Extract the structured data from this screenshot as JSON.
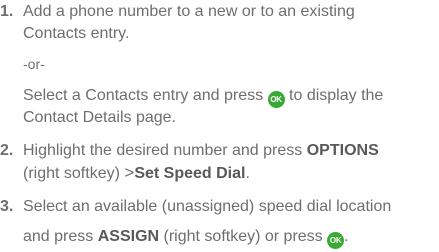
{
  "colors": {
    "text": "#6d6e70",
    "ok_icon": "#3aaa35"
  },
  "steps": [
    {
      "number": "1.",
      "line1": "Add a phone number to a new or to an existing",
      "line2": "Contacts entry.",
      "or": "-or-",
      "alt_line1_pre": "Select a Contacts entry and press",
      "alt_line1_post": "to display the",
      "alt_line2": "Contact Details page."
    },
    {
      "number": "2.",
      "line1_pre": "Highlight the desired number and press",
      "line1_bold": "OPTIONS",
      "line2_pre": "(right softkey)",
      "line2_sep": ">",
      "line2_bold": "Set Speed Dial",
      "line2_post": "."
    },
    {
      "number": "3.",
      "line1": "Select an available (unassigned) speed dial location",
      "line2_pre": "and press",
      "line2_bold": "ASSIGN",
      "line2_mid": "(right softkey) or press",
      "line2_post": "."
    }
  ],
  "ok_icon": {
    "label": "OK",
    "icon": "ok-key-icon"
  }
}
